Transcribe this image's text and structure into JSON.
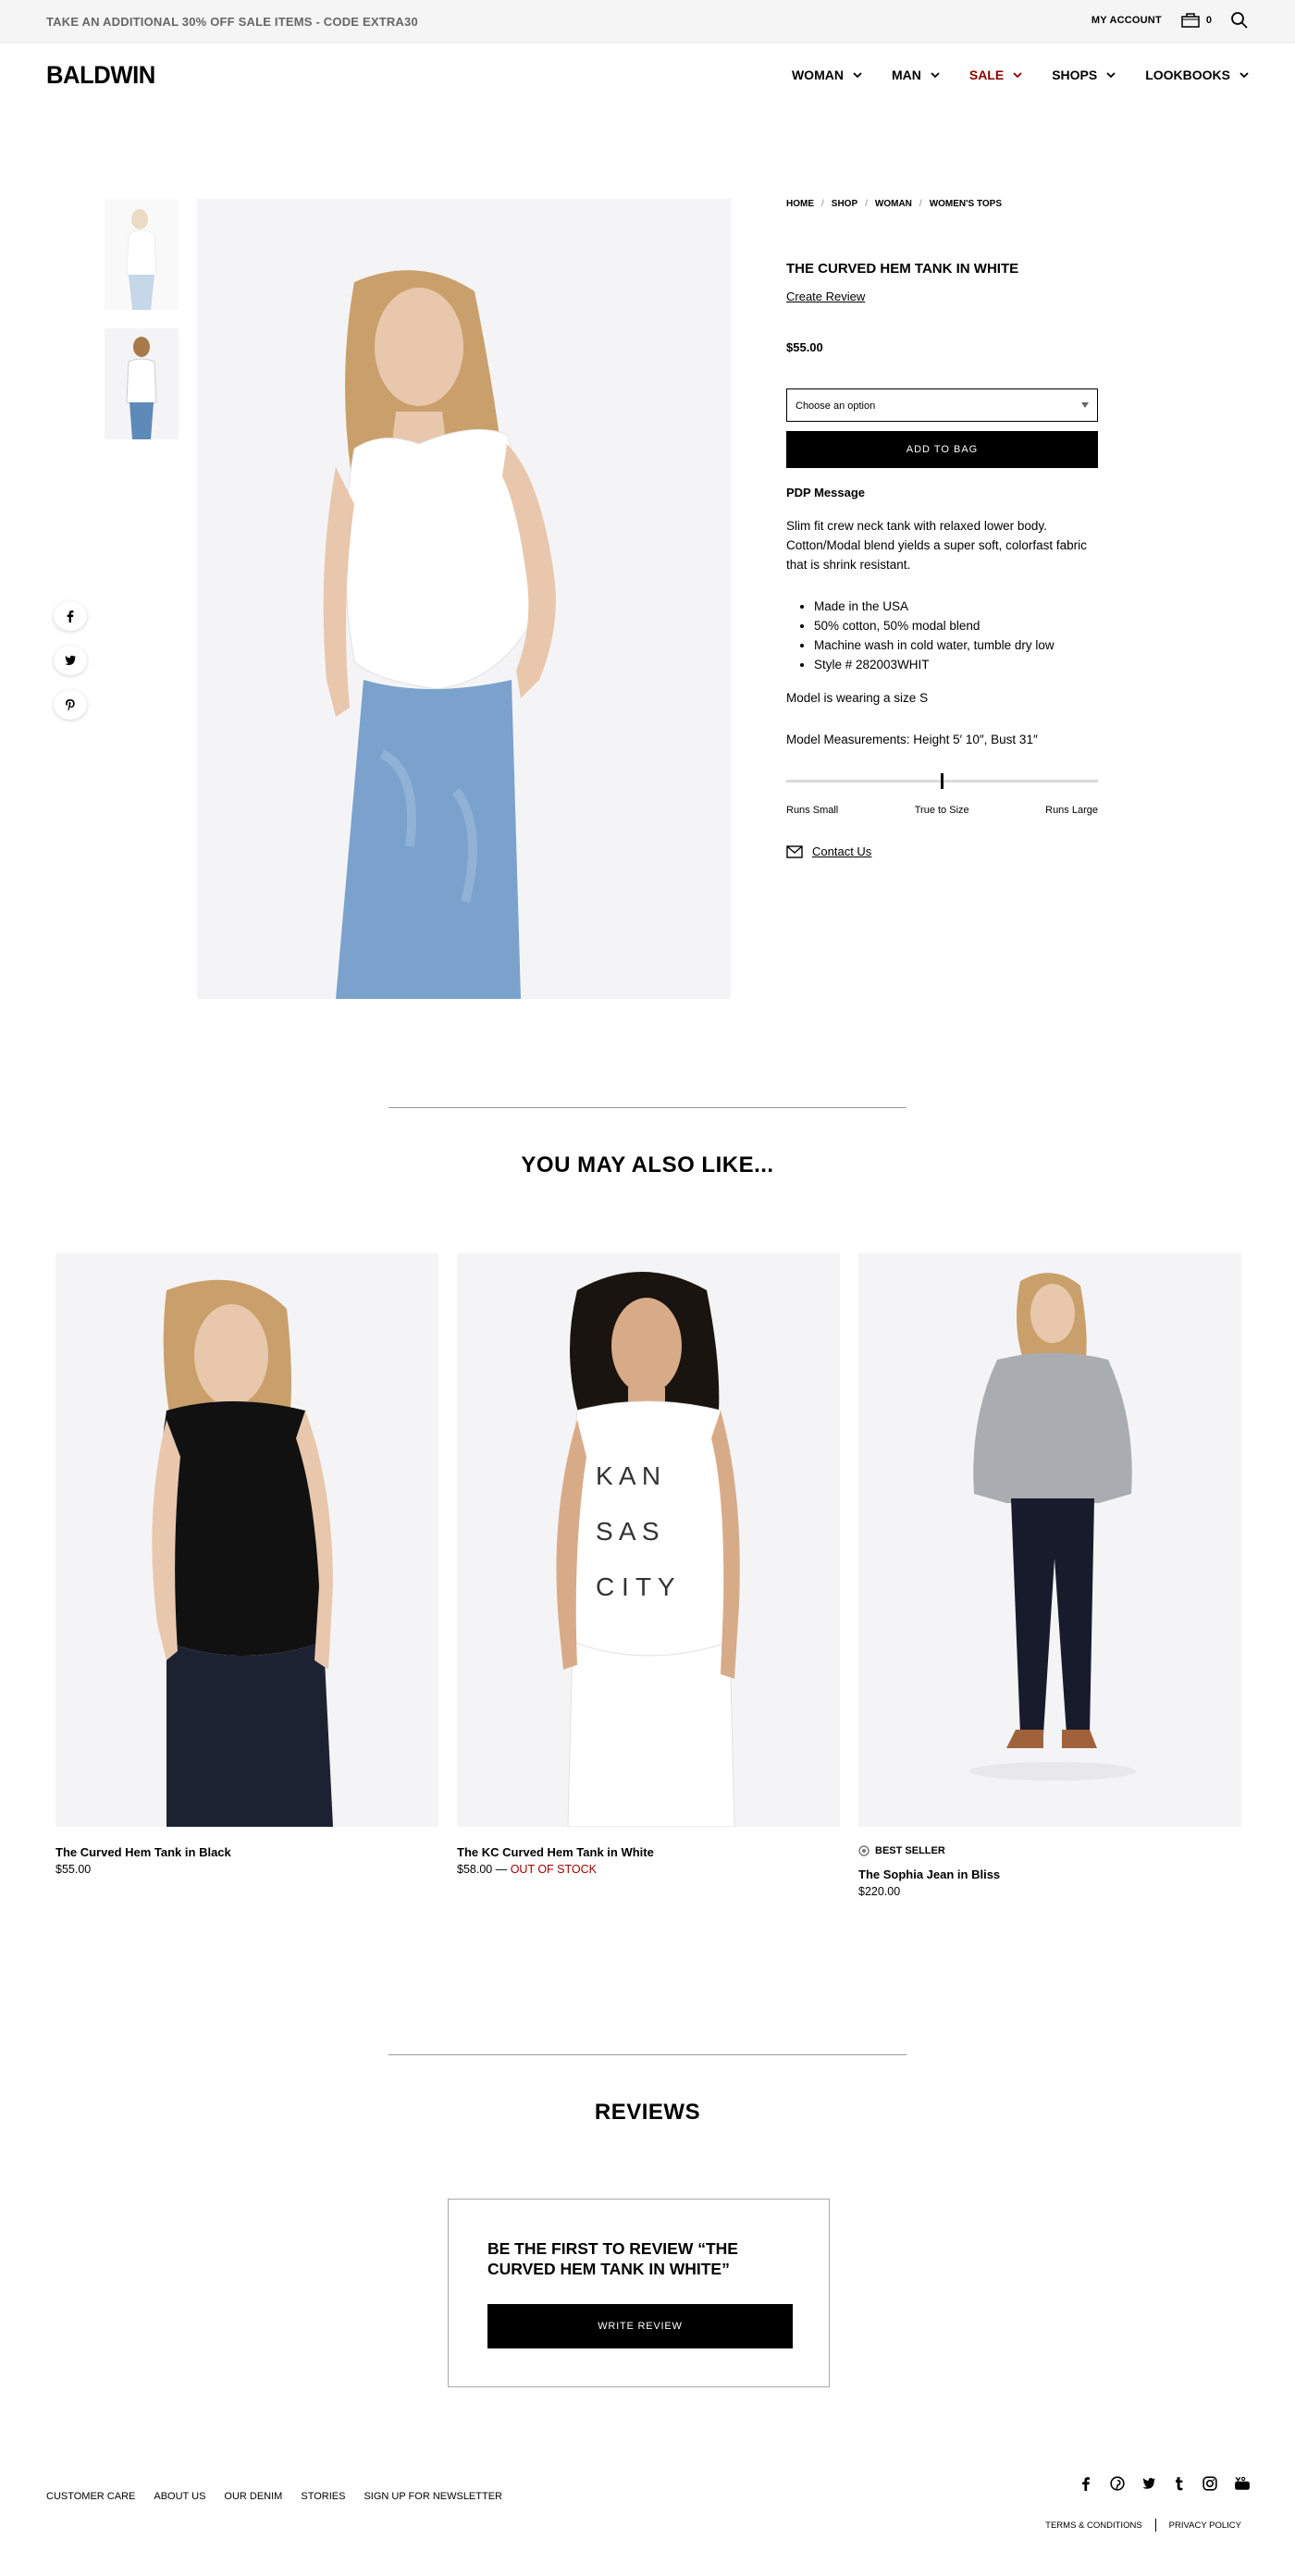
{
  "promo": {
    "text": "TAKE AN ADDITIONAL 30% OFF SALE ITEMS - CODE EXTRA30"
  },
  "header": {
    "account": "MY ACCOUNT",
    "bag_count": "0",
    "logo": "BALDWIN",
    "nav": [
      "WOMAN",
      "MAN",
      "SALE",
      "SHOPS",
      "LOOKBOOKS"
    ]
  },
  "breadcrumb": [
    "HOME",
    "SHOP",
    "WOMAN",
    "WOMEN'S TOPS"
  ],
  "product": {
    "title": "THE CURVED HEM TANK IN WHITE",
    "create_review": "Create Review",
    "price": "$55.00",
    "select_placeholder": "Choose an option",
    "add_to_bag": "ADD TO BAG",
    "pdp_heading": "PDP Message",
    "description": "Slim fit crew neck tank with relaxed lower body. Cotton/Modal blend yields a super soft, colorfast fabric that is shrink resistant.",
    "bullets": [
      "Made in the USA",
      "50% cotton, 50% modal blend",
      "Machine wash in cold water, tumble dry low",
      "Style # 282003WHIT"
    ],
    "model_size": "Model is wearing a size S",
    "model_measurements": "Model Measurements: Height 5′ 10″, Bust 31″",
    "fit_labels": [
      "Runs Small",
      "True to Size",
      "Runs Large"
    ],
    "fit_position": 0.5,
    "contact": "Contact Us"
  },
  "related": {
    "title": "YOU MAY ALSO LIKE...",
    "items": [
      {
        "name": "The Curved Hem Tank in Black",
        "price": "$55.00",
        "status": "",
        "badge": ""
      },
      {
        "name": "The KC Curved Hem Tank in White",
        "price": "$58.00 — ",
        "status": "OUT OF STOCK",
        "badge": ""
      },
      {
        "name": "The Sophia Jean in Bliss",
        "price": "$220.00",
        "status": "",
        "badge": "BEST SELLER"
      }
    ]
  },
  "reviews": {
    "title": "REVIEWS",
    "prompt": "BE THE FIRST TO REVIEW “THE CURVED HEM TANK IN WHITE”",
    "button": "WRITE REVIEW"
  },
  "footer": {
    "links": [
      "CUSTOMER CARE",
      "ABOUT US",
      "OUR DENIM",
      "STORIES",
      "SIGN UP FOR NEWSLETTER"
    ],
    "legal": [
      "TERMS & CONDITIONS",
      "PRIVACY POLICY"
    ]
  },
  "colors": {
    "sale": "#8b0000",
    "out_of_stock": "#a00000",
    "button": "#000000",
    "photo_bg": "#f4f4f6"
  }
}
